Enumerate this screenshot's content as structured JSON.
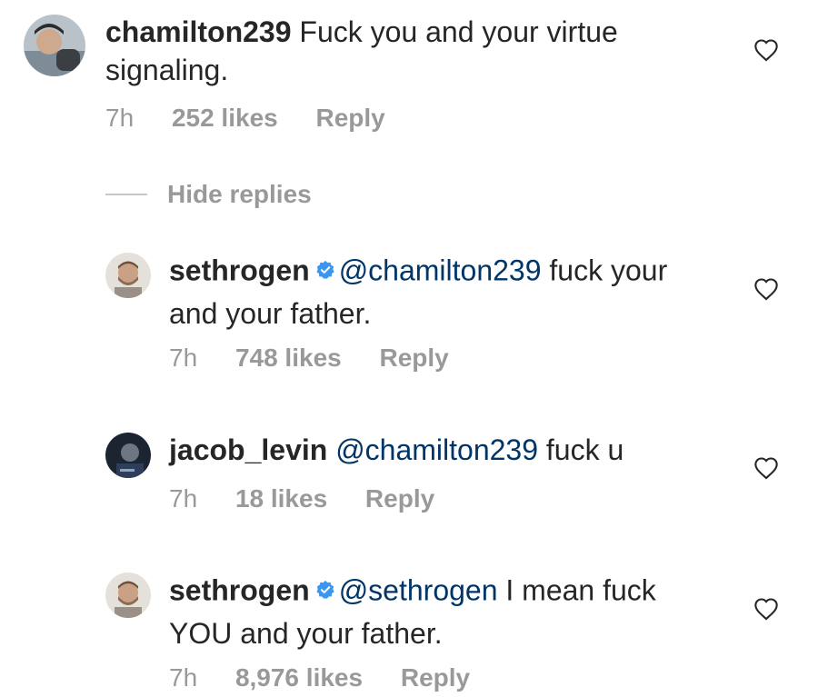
{
  "comments": [
    {
      "username": "chamilton239",
      "verified": false,
      "mention": "",
      "text": "Fuck you and your virtue signaling.",
      "time": "7h",
      "likes": "252 likes",
      "reply": "Reply"
    },
    {
      "username": "sethrogen",
      "verified": true,
      "mention": "@chamilton239",
      "text": "fuck your and your father.",
      "time": "7h",
      "likes": "748 likes",
      "reply": "Reply"
    },
    {
      "username": "jacob_levin",
      "verified": false,
      "mention": "@chamilton239",
      "text": "fuck u",
      "time": "7h",
      "likes": "18 likes",
      "reply": "Reply"
    },
    {
      "username": "sethrogen",
      "verified": true,
      "mention": "@sethrogen",
      "text": "I mean fuck YOU and your father.",
      "time": "7h",
      "likes": "8,976 likes",
      "reply": "Reply"
    }
  ],
  "hide_replies_label": "Hide replies",
  "icons": {
    "like": "heart-icon",
    "verified": "verified-badge-icon"
  },
  "colors": {
    "text": "#262626",
    "secondary": "#999999",
    "mention": "#003569",
    "verified": "#3897f0"
  }
}
